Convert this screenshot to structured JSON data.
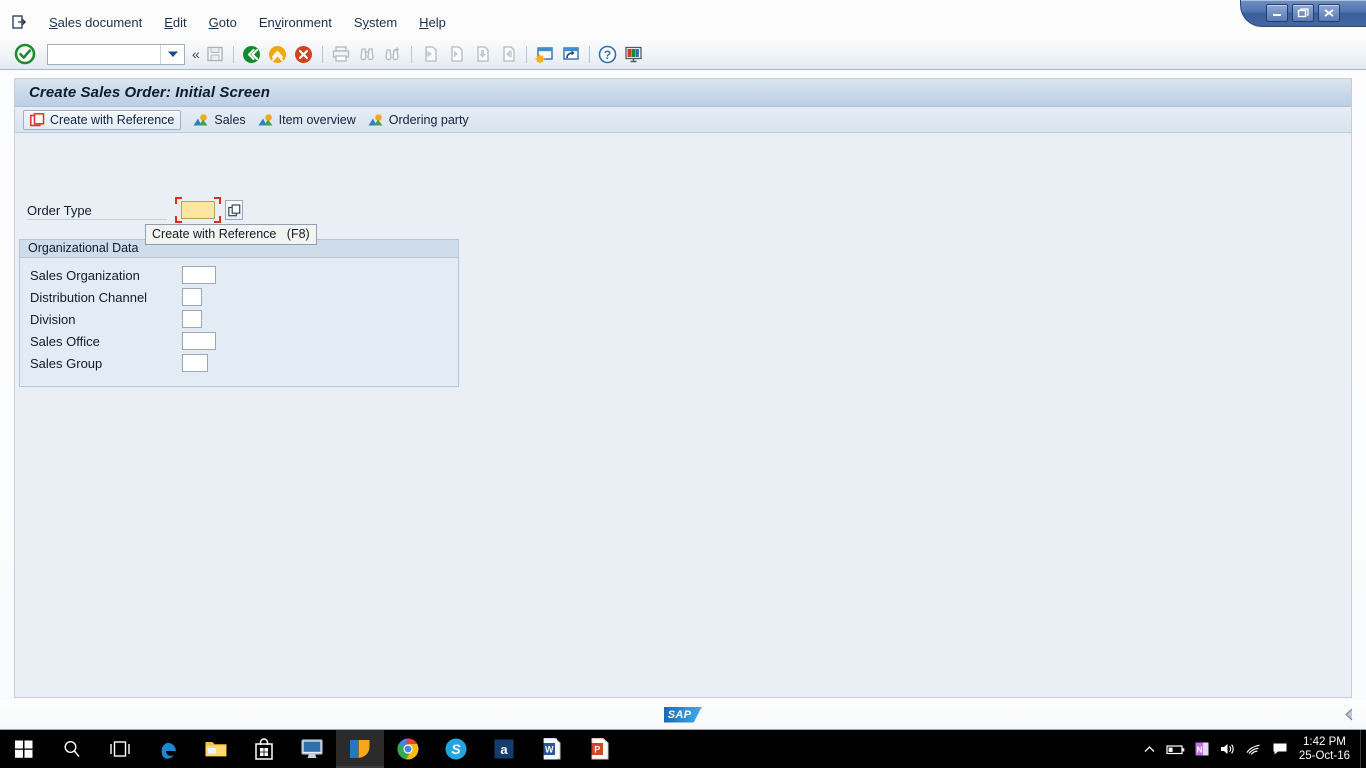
{
  "window": {
    "controls": [
      {
        "name": "minimize",
        "glyph": "_"
      },
      {
        "name": "restore",
        "glyph": "❐"
      },
      {
        "name": "close",
        "glyph": "✕"
      }
    ]
  },
  "menubar": {
    "items": [
      {
        "label": "Sales document",
        "accel": "S"
      },
      {
        "label": "Edit",
        "accel": "E"
      },
      {
        "label": "Goto",
        "accel": "G"
      },
      {
        "label": "Environment",
        "accel": "v"
      },
      {
        "label": "System",
        "accel": "y"
      },
      {
        "label": "Help",
        "accel": "H"
      }
    ]
  },
  "toolbar": {
    "ok_icon": "enter-checkmark-icon",
    "command_field": {
      "value": "",
      "placeholder": ""
    },
    "dropdown_icon": "chevron-down-icon",
    "more_icon": "double-chevron-left-icon",
    "buttons": [
      {
        "name": "save-button",
        "icon": "save-icon",
        "enabled": false
      },
      {
        "name": "back-button",
        "icon": "back-green-icon",
        "enabled": true
      },
      {
        "name": "exit-button",
        "icon": "exit-yellow-icon",
        "enabled": true
      },
      {
        "name": "cancel-button",
        "icon": "cancel-red-icon",
        "enabled": true
      },
      {
        "name": "print-button",
        "icon": "print-icon",
        "enabled": false
      },
      {
        "name": "find-button",
        "icon": "binoculars-icon",
        "enabled": false
      },
      {
        "name": "find-next-button",
        "icon": "binoculars-plus-icon",
        "enabled": false
      },
      {
        "name": "first-page-button",
        "icon": "first-page-icon",
        "enabled": false
      },
      {
        "name": "previous-page-button",
        "icon": "previous-page-icon",
        "enabled": false
      },
      {
        "name": "next-page-button",
        "icon": "next-page-icon",
        "enabled": false
      },
      {
        "name": "last-page-button",
        "icon": "last-page-icon",
        "enabled": false
      },
      {
        "name": "create-session-button",
        "icon": "new-session-icon",
        "enabled": true
      },
      {
        "name": "create-shortcut-button",
        "icon": "shortcut-icon",
        "enabled": true
      },
      {
        "name": "help-button",
        "icon": "help-question-icon",
        "enabled": true
      },
      {
        "name": "layout-menu-button",
        "icon": "customize-layout-icon",
        "enabled": true
      }
    ]
  },
  "screen": {
    "title": "Create Sales Order: Initial Screen",
    "app_toolbar": [
      {
        "label": "Create with Reference",
        "icon": "create-with-reference-icon",
        "framed": true
      },
      {
        "label": "Sales",
        "icon": "landscape-icon",
        "framed": false
      },
      {
        "label": "Item overview",
        "icon": "landscape-icon",
        "framed": false
      },
      {
        "label": "Ordering party",
        "icon": "landscape-icon",
        "framed": false
      }
    ],
    "tooltip": "Create with Reference   (F8)"
  },
  "form": {
    "order_type": {
      "label": "Order Type",
      "value": "",
      "required": true,
      "search_help_icon": "search-help-icon"
    },
    "organizational_data": {
      "title": "Organizational Data",
      "fields": [
        {
          "label": "Sales Organization",
          "value": "",
          "size": "lg"
        },
        {
          "label": "Distribution Channel",
          "value": "",
          "size": "sm"
        },
        {
          "label": "Division",
          "value": "",
          "size": "sm"
        },
        {
          "label": "Sales Office",
          "value": "",
          "size": "lg"
        },
        {
          "label": "Sales Group",
          "value": "",
          "size": "md"
        }
      ]
    }
  },
  "statusbar": {
    "logo_text": "SAP",
    "collapse_icon": "collapse-left-icon"
  },
  "taskbar": {
    "items": [
      {
        "name": "start-button",
        "icon": "windows-logo-icon",
        "active": false
      },
      {
        "name": "search-button",
        "icon": "search-icon",
        "active": false
      },
      {
        "name": "task-view-button",
        "icon": "task-view-icon",
        "active": false
      },
      {
        "name": "edge-button",
        "icon": "edge-icon",
        "active": false
      },
      {
        "name": "file-explorer-button",
        "icon": "folder-icon",
        "active": false
      },
      {
        "name": "store-button",
        "icon": "store-bag-icon",
        "active": false
      },
      {
        "name": "remote-desktop-button",
        "icon": "monitor-icon",
        "active": false
      },
      {
        "name": "sap-logon-button",
        "icon": "sap-gui-icon",
        "active": true
      },
      {
        "name": "chrome-button",
        "icon": "chrome-icon",
        "active": false
      },
      {
        "name": "skype-button",
        "icon": "skype-icon",
        "active": false
      },
      {
        "name": "access-button",
        "icon": "access-icon",
        "active": false
      },
      {
        "name": "word-button",
        "icon": "word-icon",
        "active": false
      },
      {
        "name": "powerpoint-button",
        "icon": "powerpoint-icon",
        "active": false
      }
    ],
    "tray": [
      {
        "name": "show-hidden-icons",
        "icon": "chevron-up-icon"
      },
      {
        "name": "battery-status",
        "icon": "battery-icon"
      },
      {
        "name": "onenote-tray",
        "icon": "onenote-icon"
      },
      {
        "name": "volume",
        "icon": "speaker-icon"
      },
      {
        "name": "network",
        "icon": "wifi-icon"
      },
      {
        "name": "action-center",
        "icon": "action-center-icon"
      }
    ],
    "clock": {
      "time": "1:42 PM",
      "date": "25-Oct-16"
    }
  },
  "colors": {
    "accent_blue": "#3b5e9e",
    "required_field": "#fbe6a2",
    "focus_bracket": "#e02b1d",
    "canvas": "#eaeff5"
  }
}
